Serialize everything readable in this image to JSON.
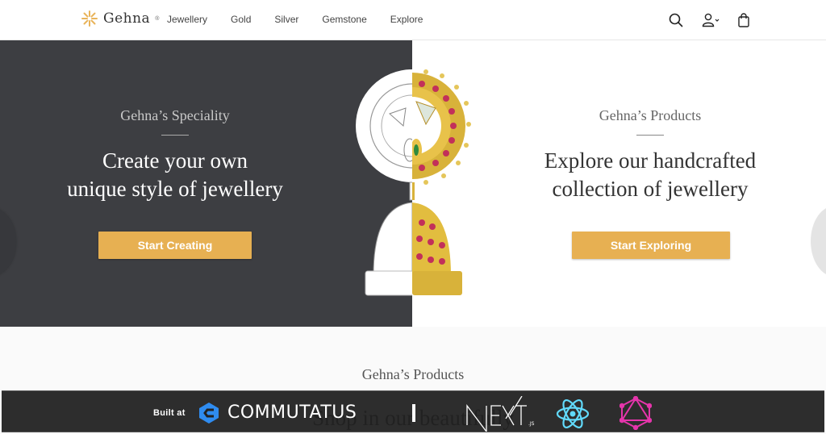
{
  "header": {
    "brand": "Gehna",
    "brand_mark": "®",
    "logo_icon": "sunburst-icon",
    "nav": [
      {
        "label": "Jewellery"
      },
      {
        "label": "Gold"
      },
      {
        "label": "Silver"
      },
      {
        "label": "Gemstone"
      },
      {
        "label": "Explore"
      }
    ],
    "icons": [
      "search-icon",
      "user-icon",
      "shopping-bag-icon"
    ]
  },
  "hero": {
    "left": {
      "eyebrow": "Gehna’s Speciality",
      "headline_line1": "Create your own",
      "headline_line2": "unique style of jewellery",
      "cta": "Start Creating"
    },
    "right": {
      "eyebrow": "Gehna’s Products",
      "headline_line1": "Explore our handcrafted",
      "headline_line2": "collection of jewellery",
      "cta": "Start Exploring"
    }
  },
  "products": {
    "eyebrow": "Gehna’s Products",
    "headline": "Shop in our beautifully"
  },
  "banner": {
    "built_at": "Built at",
    "company": "COMMUTATUS",
    "next_label": "NEXT",
    "next_suffix": ".JS"
  },
  "colors": {
    "accent": "#e7b052",
    "hero_dark": "#3d3e42",
    "react": "#61dafb",
    "graphql": "#e535ab",
    "commutatus": "#2f8cf0"
  }
}
